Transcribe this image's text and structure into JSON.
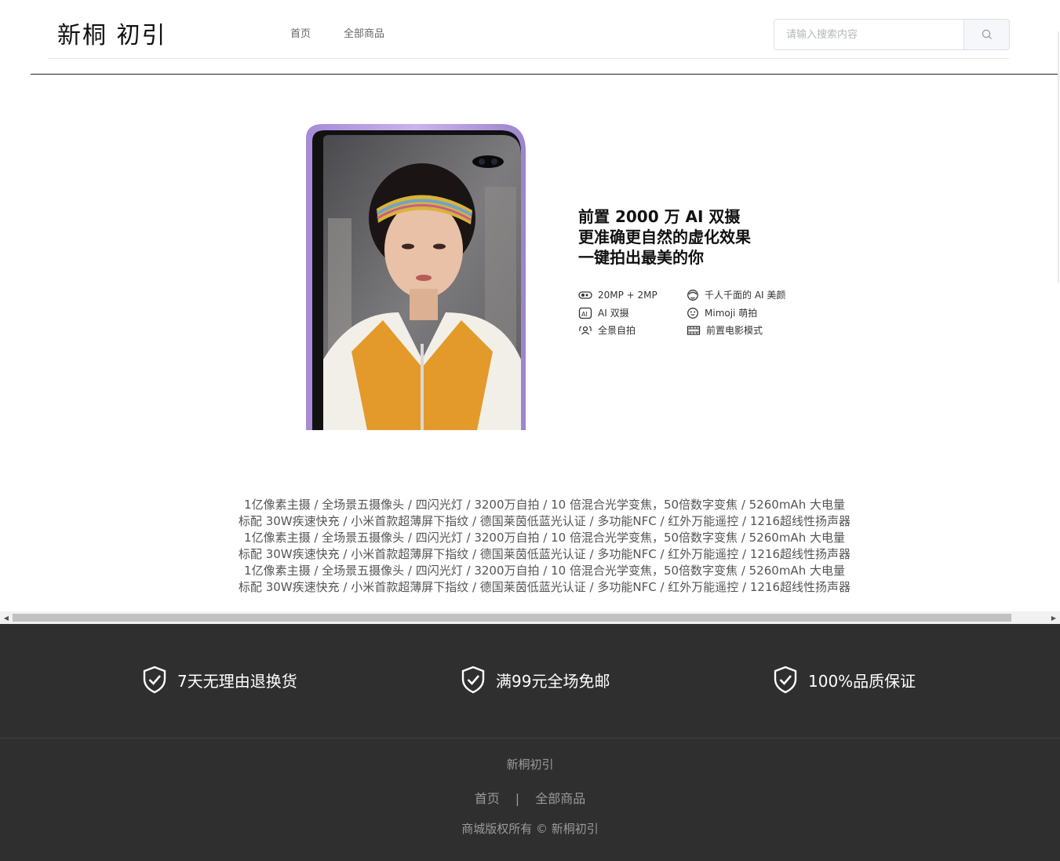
{
  "header": {
    "logo": "新桐 初引",
    "nav": [
      "首页",
      "全部商品"
    ],
    "search": {
      "placeholder": "请输入搜索内容"
    }
  },
  "hero": {
    "title_lines": [
      "前置 2000 万 AI 双摄",
      "更准确更自然的虚化效果",
      "一键拍出最美的你"
    ],
    "features": [
      {
        "icon": "dual-camera-icon",
        "label": "20MP + 2MP"
      },
      {
        "icon": "face-beauty-icon",
        "label": "千人千面的 AI 美颜"
      },
      {
        "icon": "ai-badge-icon",
        "label": "AI 双摄"
      },
      {
        "icon": "smiley-icon",
        "label": "Mimoji 萌拍"
      },
      {
        "icon": "panorama-selfie-icon",
        "label": "全景自拍"
      },
      {
        "icon": "film-icon",
        "label": "前置电影模式"
      }
    ]
  },
  "specs": [
    "1亿像素主摄 / 全场景五摄像头 / 四闪光灯 / 3200万自拍 / 10 倍混合光学变焦，50倍数字变焦 / 5260mAh 大电量",
    "标配 30W疾速快充 / 小米首款超薄屏下指纹 / 德国莱茵低蓝光认证 / 多功能NFC / 红外万能遥控 / 1216超线性扬声器",
    "1亿像素主摄 / 全场景五摄像头 / 四闪光灯 / 3200万自拍 / 10 倍混合光学变焦，50倍数字变焦 / 5260mAh 大电量",
    "标配 30W疾速快充 / 小米首款超薄屏下指纹 / 德国莱茵低蓝光认证 / 多功能NFC / 红外万能遥控 / 1216超线性扬声器",
    "1亿像素主摄 / 全场景五摄像头 / 四闪光灯 / 3200万自拍 / 10 倍混合光学变焦，50倍数字变焦 / 5260mAh 大电量",
    "标配 30W疾速快充 / 小米首款超薄屏下指纹 / 德国莱茵低蓝光认证 / 多功能NFC / 红外万能遥控 / 1216超线性扬声器"
  ],
  "footer": {
    "promises": [
      "7天无理由退换货",
      "满99元全场免邮",
      "100%品质保证"
    ],
    "brand": "新桐初引",
    "links": [
      "首页",
      "全部商品"
    ],
    "link_separator": "|",
    "copyright": "商城版权所有 © 新桐初引"
  },
  "colors": {
    "footer_bg": "#2f2f2f",
    "phone_frame": "#b79fe0",
    "accent_text": "#111111"
  }
}
